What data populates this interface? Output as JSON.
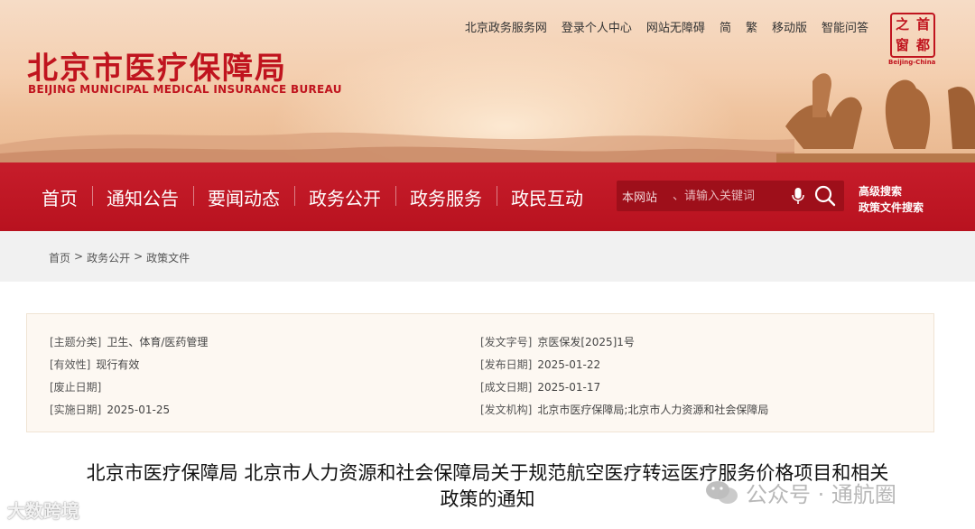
{
  "header": {
    "title_cn": "北京市医疗保障局",
    "title_en": "BEIJING MUNICIPAL MEDICAL INSURANCE BUREAU",
    "top_links": [
      "北京政务服务网",
      "登录个人中心",
      "网站无障碍",
      "简",
      "繁",
      "移动版",
      "智能问答"
    ],
    "seal_chars": [
      "首",
      "都",
      "之",
      "窗"
    ],
    "seal_en": "Beijing-China"
  },
  "nav": {
    "items": [
      "首页",
      "通知公告",
      "要闻动态",
      "政务公开",
      "政务服务",
      "政民互动"
    ]
  },
  "search": {
    "scope": "本网站",
    "placeholder": "、请输入关键词",
    "advanced": "高级搜索",
    "policy": "政策文件搜索"
  },
  "breadcrumb": [
    "首页",
    ">",
    "政务公开",
    ">",
    "政策文件"
  ],
  "meta": {
    "topic_label": "[主题分类]",
    "topic": "卫生、体育/医药管理",
    "validity_label": "[有效性]",
    "validity": "现行有效",
    "repeal_label": "[废止日期]",
    "repeal": "",
    "effective_label": "[实施日期]",
    "effective": "2025-01-25",
    "doc_no_label": "[发文字号]",
    "doc_no": "京医保发[2025]1号",
    "publish_label": "[发布日期]",
    "publish": "2025-01-22",
    "written_label": "[成文日期]",
    "written": "2025-01-17",
    "issuer_label": "[发文机构]",
    "issuer": "北京市医疗保障局;北京市人力资源和社会保障局"
  },
  "document": {
    "title_line1": "北京市医疗保障局 北京市人力资源和社会保障局关于规范航空医疗转运医疗服务价格项目和相关",
    "title_line2": "政策的通知"
  },
  "watermarks": {
    "left": "大数跨境",
    "right": "公众号 · 通航圈"
  },
  "colors": {
    "brand_red": "#c0141e",
    "nav_red": "#b8121f",
    "meta_bg": "#fdf8f2"
  }
}
